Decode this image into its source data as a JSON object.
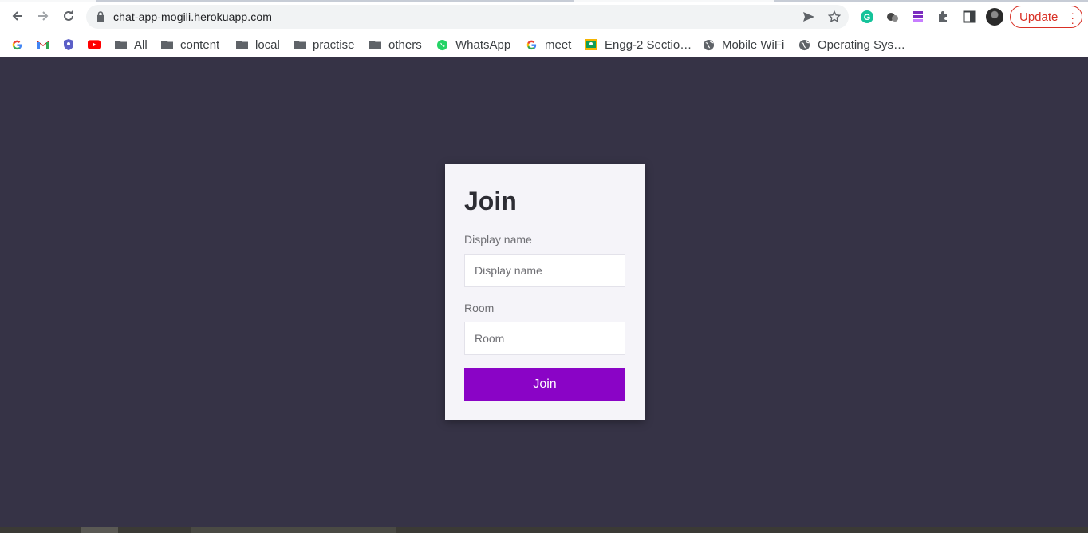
{
  "browser": {
    "url": "chat-app-mogili.herokuapp.com",
    "update_label": "Update",
    "accent": "#d93025"
  },
  "bookmarks": [
    {
      "label": "",
      "icon": "google-icon"
    },
    {
      "label": "",
      "icon": "gmail-icon"
    },
    {
      "label": "",
      "icon": "shield-icon"
    },
    {
      "label": "",
      "icon": "youtube-icon"
    },
    {
      "label": "All",
      "icon": "folder-icon"
    },
    {
      "label": "content",
      "icon": "folder-icon"
    },
    {
      "label": "local",
      "icon": "folder-icon"
    },
    {
      "label": "practise",
      "icon": "folder-icon"
    },
    {
      "label": "others",
      "icon": "folder-icon"
    },
    {
      "label": "WhatsApp",
      "icon": "whatsapp-icon"
    },
    {
      "label": "meet",
      "icon": "google-icon"
    },
    {
      "label": "Engg-2 Sectio…",
      "icon": "classroom-icon"
    },
    {
      "label": "Mobile WiFi",
      "icon": "globe-icon"
    },
    {
      "label": "Operating Sys…",
      "icon": "globe-icon"
    }
  ],
  "page": {
    "background": "#363346",
    "title": "Join",
    "display_name": {
      "label": "Display name",
      "placeholder": "Display name",
      "value": ""
    },
    "room": {
      "label": "Room",
      "placeholder": "Room",
      "value": ""
    },
    "join_button": "Join",
    "button_color": "#8a04c6"
  }
}
